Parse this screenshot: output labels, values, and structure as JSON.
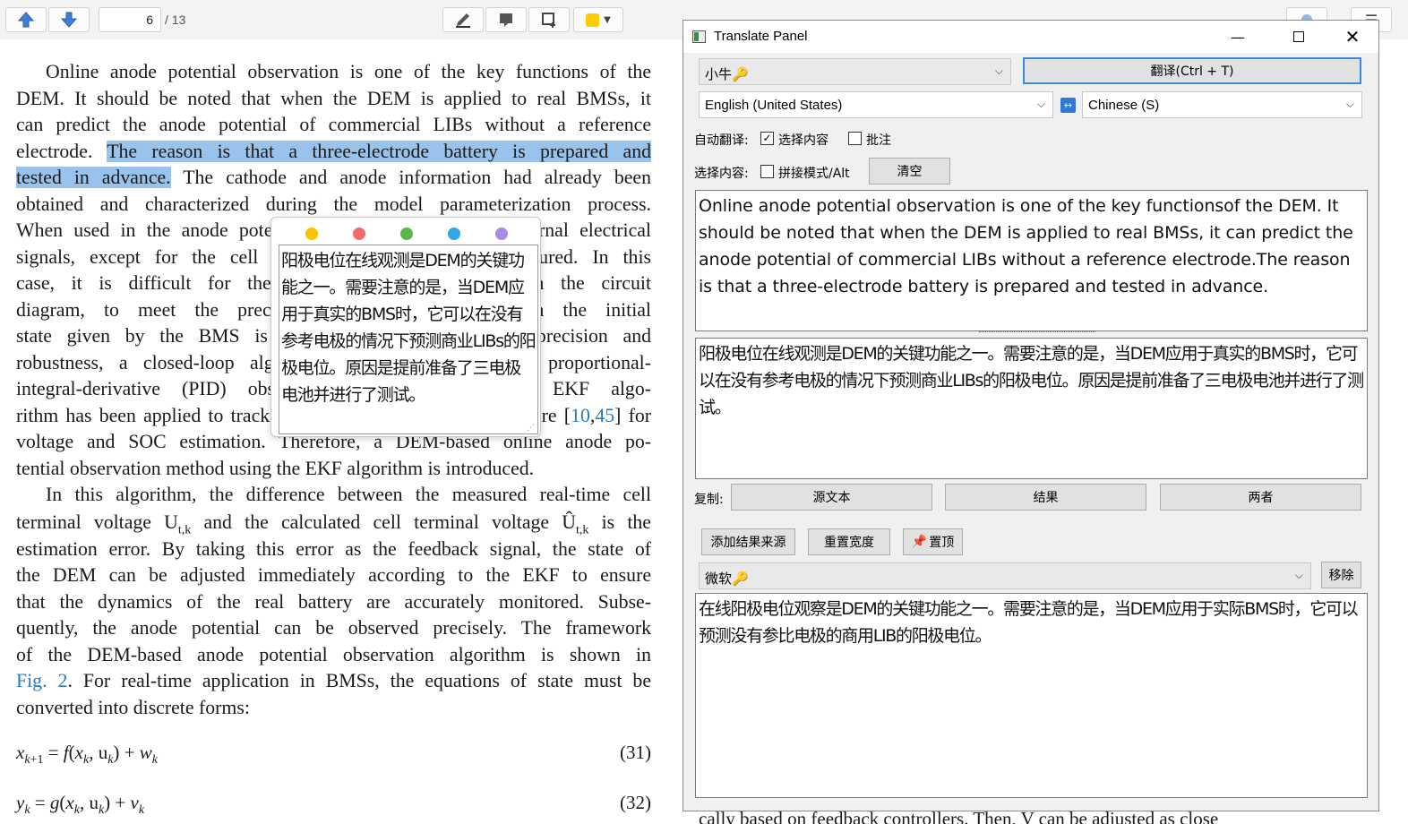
{
  "viewer": {
    "page_current": "6",
    "page_total": "/ 13",
    "highlight_color": "#ffcc00"
  },
  "pdf": {
    "lines": [
      {
        "t": "Online anode potential observation is one of the key functions of the",
        "cls": "indent"
      },
      {
        "t": "DEM. It should be noted that when the DEM is applied to real BMSs, it"
      },
      {
        "t": "can predict the anode potential of commercial LIBs without a reference"
      },
      {
        "pre": "electrode. ",
        "hl": "The reason is that a three-electrode battery is prepared and"
      },
      {
        "hl": "tested in advance.",
        "post": " The cathode and anode information had already been"
      },
      {
        "t": "obtained and characterized during the model parameterization process."
      },
      {
        "t": "When used in the anode potential observation, only the external electrical"
      },
      {
        "t": "signals, except for the cell temperature, need to be measured. In this"
      },
      {
        "t": "case, it is difficult for the simplified DEM to maintain the circuit"
      },
      {
        "t": "diagram, to meet the precision requirement, even when the initial"
      },
      {
        "t": "state given by the BMS is inaccurate. To improve the precision and"
      },
      {
        "t": "robustness, a closed-loop algorithm is necessary, such as proportional-"
      },
      {
        "t": "integral-derivative (PID) observers and the EKF. The EKF algo-"
      },
      {
        "pre": "rithm has been applied to track the nonlinear state in the literature [",
        "c1": "10",
        "mid": ",",
        "c2": "45",
        "post": "] for"
      },
      {
        "t": "voltage and SOC estimation. Therefore, a DEM-based online anode po-"
      },
      {
        "t": "tential observation method using the EKF algorithm is introduced.",
        "cls": "last"
      },
      {
        "t": "In this algorithm, the difference between the measured real-time cell",
        "cls": "indent"
      }
    ],
    "line_u1": {
      "a": "terminal voltage U",
      "s1": "t,k",
      "b": " and the calculated cell terminal voltage ",
      "c": "Û",
      "s2": "t,k",
      "d": " is the"
    },
    "lines2": [
      {
        "t": "estimation error. By taking this error as the feedback signal, the state of"
      },
      {
        "t": "the DEM can be adjusted immediately according to the EKF to ensure"
      },
      {
        "t": "that the dynamics of the real battery are accurately monitored. Subse-"
      },
      {
        "t": "quently, the anode potential can be observed precisely. The framework"
      },
      {
        "t": "of the DEM-based anode potential observation algorithm is shown in"
      },
      {
        "cite": "Fig. 2",
        "post": ". For real-time application in BMSs, the equations of state must be"
      },
      {
        "t": "converted into discrete forms:",
        "cls": "last"
      }
    ],
    "eq31_num": "(31)",
    "eq32_num": "(32)",
    "bottom_fragment": "cally based on feedback controllers. Then, V̂ can be adjusted as close"
  },
  "popup": {
    "colors": [
      "#f6c400",
      "#f26b6b",
      "#5cb548",
      "#2ea8e6",
      "#a98be6"
    ],
    "text": "阳极电位在线观测是DEM的关键功能之一。需要注意的是，当DEM应用于真实的BMS时，它可以在没有参考电极的情况下预测商业LIBs的阳极电位。原因是提前准备了三电极电池并进行了测试。"
  },
  "panel": {
    "title": "Translate Panel",
    "engine_top": "小牛🔑",
    "translate_btn": "翻译(Ctrl + T)",
    "source_lang": "English (United States)",
    "target_lang": "Chinese (S)",
    "auto_translate_label": "自动翻译:",
    "opt_selection": "选择内容",
    "opt_comment": "批注",
    "select_label": "选择内容:",
    "opt_concat": "拼接模式/Alt",
    "clear_btn": "清空",
    "source_text": "Online anode potential observation is one of the key functionsof the DEM. It should be noted that when the DEM is applied to real BMSs, it can predict the anode potential of commercial LIBs without a reference electrode.The reason is that a three-electrode battery is prepared and tested in advance.",
    "result1": "阳极电位在线观测是DEM的关键功能之一。需要注意的是，当DEM应用于真实的BMS时，它可以在没有参考电极的情况下预测商业LIBs的阳极电位。原因是提前准备了三电极电池并进行了测试。",
    "copy_label": "复制:",
    "copy_source": "源文本",
    "copy_result": "结果",
    "copy_both": "两者",
    "add_source_btn": "添加结果来源",
    "reset_width_btn": "重置宽度",
    "pin_btn": "置顶",
    "engine2": "微软🔑",
    "remove_btn": "移除",
    "result2": "在线阳极电位观察是DEM的关键功能之一。需要注意的是，当DEM应用于实际BMS时，它可以预测没有参比电极的商用LIB的阳极电位。"
  }
}
